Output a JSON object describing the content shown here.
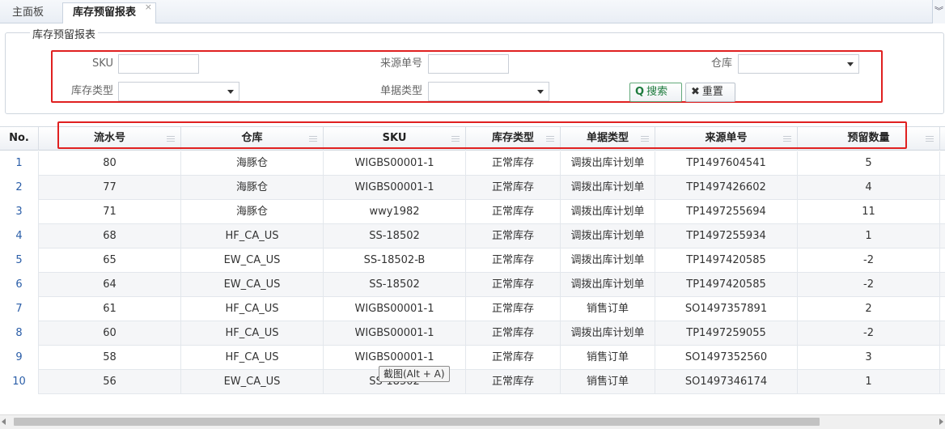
{
  "tabs": [
    {
      "label": "主面板"
    },
    {
      "label": "库存预留报表",
      "close": "×"
    }
  ],
  "tab_menu_icon": "double-chevron-down-icon",
  "tab_menu_glyph": "︾",
  "filter": {
    "legend": "库存预留报表",
    "sku_label": "SKU",
    "sku_value": "",
    "source_no_label": "来源单号",
    "source_no_value": "",
    "warehouse_label": "仓库",
    "warehouse_value": "",
    "stock_type_label": "库存类型",
    "stock_type_value": "",
    "doc_type_label": "单据类型",
    "doc_type_value": "",
    "search_label": "搜索",
    "search_icon": "search-icon",
    "search_glyph": "Q",
    "reset_label": "重置",
    "reset_icon": "close-icon",
    "reset_glyph": "✖"
  },
  "grid": {
    "columns": [
      "No.",
      "流水号",
      "仓库",
      "SKU",
      "库存类型",
      "单据类型",
      "来源单号",
      "预留数量"
    ],
    "rows": [
      {
        "no": "1",
        "serial": "80",
        "warehouse": "海豚仓",
        "sku": "WIGBS00001-1",
        "stock_type": "正常库存",
        "doc_type": "调拨出库计划单",
        "source_no": "TP1497604541",
        "qty": "5"
      },
      {
        "no": "2",
        "serial": "77",
        "warehouse": "海豚仓",
        "sku": "WIGBS00001-1",
        "stock_type": "正常库存",
        "doc_type": "调拨出库计划单",
        "source_no": "TP1497426602",
        "qty": "4"
      },
      {
        "no": "3",
        "serial": "71",
        "warehouse": "海豚仓",
        "sku": "wwy1982",
        "stock_type": "正常库存",
        "doc_type": "调拨出库计划单",
        "source_no": "TP1497255694",
        "qty": "11"
      },
      {
        "no": "4",
        "serial": "68",
        "warehouse": "HF_CA_US",
        "sku": "SS-18502",
        "stock_type": "正常库存",
        "doc_type": "调拨出库计划单",
        "source_no": "TP1497255934",
        "qty": "1"
      },
      {
        "no": "5",
        "serial": "65",
        "warehouse": "EW_CA_US",
        "sku": "SS-18502-B",
        "stock_type": "正常库存",
        "doc_type": "调拨出库计划单",
        "source_no": "TP1497420585",
        "qty": "-2"
      },
      {
        "no": "6",
        "serial": "64",
        "warehouse": "EW_CA_US",
        "sku": "SS-18502",
        "stock_type": "正常库存",
        "doc_type": "调拨出库计划单",
        "source_no": "TP1497420585",
        "qty": "-2"
      },
      {
        "no": "7",
        "serial": "61",
        "warehouse": "HF_CA_US",
        "sku": "WIGBS00001-1",
        "stock_type": "正常库存",
        "doc_type": "销售订单",
        "source_no": "SO1497357891",
        "qty": "2"
      },
      {
        "no": "8",
        "serial": "60",
        "warehouse": "HF_CA_US",
        "sku": "WIGBS00001-1",
        "stock_type": "正常库存",
        "doc_type": "调拨出库计划单",
        "source_no": "TP1497259055",
        "qty": "-2"
      },
      {
        "no": "9",
        "serial": "58",
        "warehouse": "HF_CA_US",
        "sku": "WIGBS00001-1",
        "stock_type": "正常库存",
        "doc_type": "销售订单",
        "source_no": "SO1497352560",
        "qty": "3"
      },
      {
        "no": "10",
        "serial": "56",
        "warehouse": "EW_CA_US",
        "sku": "SS-18502",
        "stock_type": "正常库存",
        "doc_type": "销售订单",
        "source_no": "SO1497346174",
        "qty": "1"
      }
    ]
  },
  "tooltip": "截图(Alt + A)",
  "colors": {
    "highlight": "#e02020",
    "row_number": "#2b5ea8",
    "search_button": "#1e7b3e"
  }
}
